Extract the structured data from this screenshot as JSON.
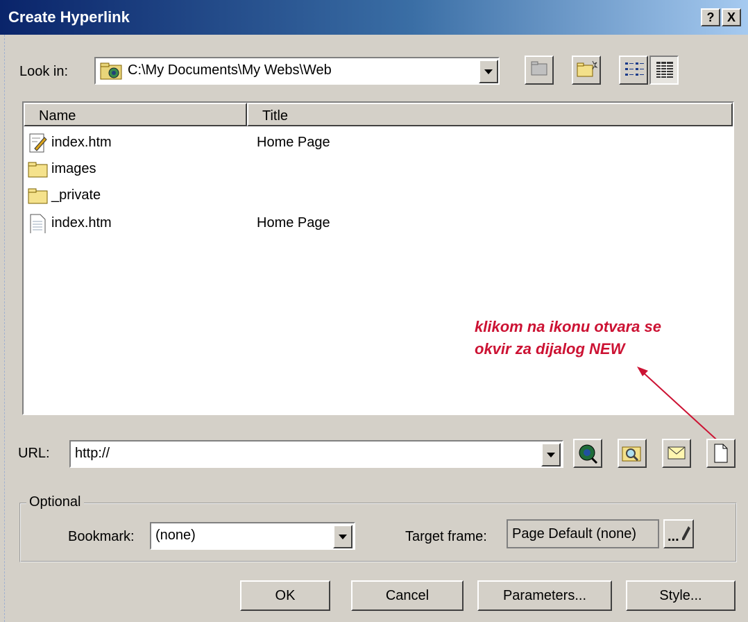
{
  "dialog": {
    "title": "Create Hyperlink",
    "help_label": "?",
    "close_label": "X"
  },
  "lookin": {
    "label": "Look in:",
    "value": "C:\\My Documents\\My Webs\\Web"
  },
  "list": {
    "columns": [
      "Name",
      "Title"
    ],
    "rows": [
      {
        "name": "index.htm",
        "title": "Home Page",
        "icon": "edited-page-icon"
      },
      {
        "name": "images",
        "title": "",
        "icon": "folder-icon"
      },
      {
        "name": "_private",
        "title": "",
        "icon": "folder-icon"
      },
      {
        "name": "index.htm",
        "title": "Home Page",
        "icon": "page-icon"
      }
    ]
  },
  "annotation": {
    "line1": "klikom na ikonu otvara se",
    "line2": "okvir za dijalog NEW",
    "color": "#cc1233"
  },
  "url": {
    "label": "URL:",
    "value": "http://"
  },
  "optional": {
    "legend": "Optional",
    "bookmark_label": "Bookmark:",
    "bookmark_value": "(none)",
    "target_label": "Target frame:",
    "target_value": "Page Default (none)",
    "target_btn": "..."
  },
  "buttons": {
    "ok": "OK",
    "cancel": "Cancel",
    "parameters": "Parameters...",
    "style": "Style..."
  }
}
